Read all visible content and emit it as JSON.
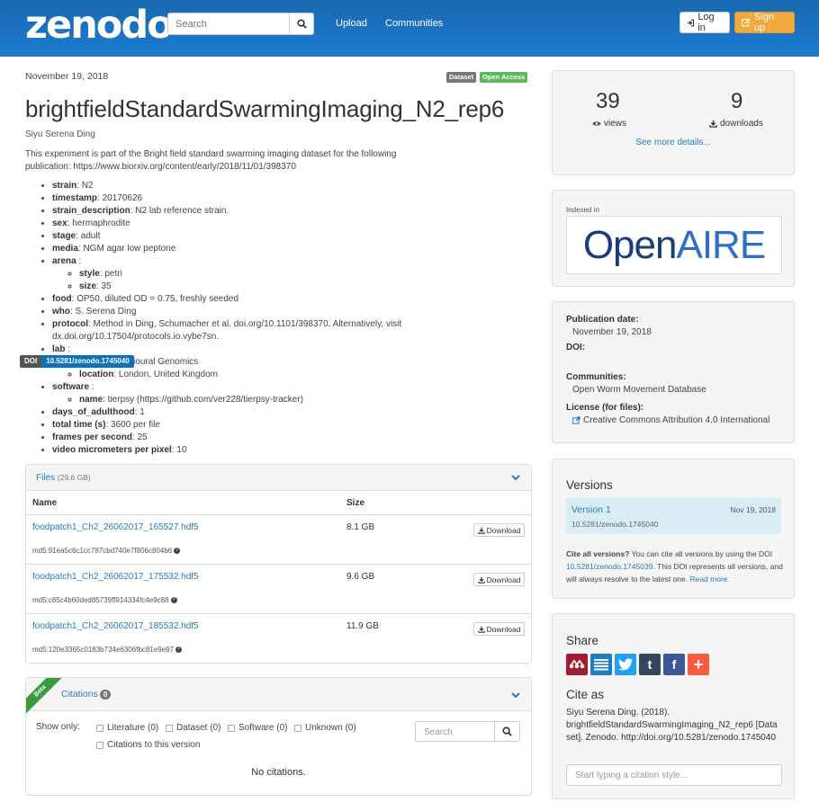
{
  "header": {
    "logo": "zenodo",
    "search_placeholder": "Search",
    "nav": [
      "Upload",
      "Communities"
    ],
    "login_label": "Log in",
    "signup_label": "Sign up"
  },
  "record": {
    "date": "November 19, 2018",
    "badges": [
      "Dataset",
      "Open Access"
    ],
    "title": "brightfieldStandardSwarmingImaging_N2_rep6",
    "author": "Siyu Serena Ding",
    "description": "This experiment is part of the Bright field standard swarming imaging dataset for the following publication: https://www.biorxiv.org/content/early/2018/11/01/398370",
    "metadata": {
      "strain": {
        "k": "strain",
        "v": ": N2"
      },
      "timestamp": {
        "k": "timestamp",
        "v": ": 20170626"
      },
      "strain_description": {
        "k": "strain_description",
        "v": ": N2 lab reference strain."
      },
      "sex": {
        "k": "sex",
        "v": ": hermaphrodite"
      },
      "stage": {
        "k": "stage",
        "v": ": adult"
      },
      "media": {
        "k": "media",
        "v": ": NGM agar low peptone"
      },
      "arena": {
        "k": "arena",
        "v": " :"
      },
      "arena_style": {
        "k": "style",
        "v": ": petri"
      },
      "arena_size": {
        "k": "size",
        "v": ": 35"
      },
      "food": {
        "k": "food",
        "v": ": OP50, diluted OD = 0.75, freshly seeded"
      },
      "who": {
        "k": "who",
        "v": ": S. Serena Ding"
      },
      "protocol": {
        "k": "protocol",
        "v": ": Method in Ding, Schumacher et al. doi.org/10.1101/398370. Alternatively, visit dx.doi.org/10.17504/protocols.io.vybe7sn."
      },
      "lab": {
        "k": "lab",
        "v": " :"
      },
      "lab_name": {
        "k": "name",
        "v": ": Behavioural Genomics"
      },
      "lab_location": {
        "k": "location",
        "v": ": London, United Kingdom"
      },
      "software": {
        "k": "software",
        "v": " :"
      },
      "software_name": {
        "k": "name",
        "v": ": tierpsy (https://github.com/ver228/tierpsy-tracker)"
      },
      "days_of_adulthood": {
        "k": "days_of_adulthood",
        "v": ": 1"
      },
      "total_time": {
        "k": "total time (s)",
        "v": ": 3600 per file"
      },
      "fps": {
        "k": "frames per second",
        "v": ": 25"
      },
      "vmpp": {
        "k": "video micrometers per pixel",
        "v": ": 10"
      }
    }
  },
  "files": {
    "label": "Files",
    "total_size": "(29.6 GB)",
    "col_name": "Name",
    "col_size": "Size",
    "download_label": "Download",
    "rows": [
      {
        "name": "foodpatch1_Ch2_26062017_165527.hdf5",
        "size": "8.1 GB",
        "md5": "md5:91ea5c6c1cc787cbd740e7f806c804b6"
      },
      {
        "name": "foodpatch1_Ch2_26062017_175532.hdf5",
        "size": "9.6 GB",
        "md5": "md5:c85c4b60ded85739ff914334fc4e9c88"
      },
      {
        "name": "foodpatch1_Ch2_26062017_185532.hdf5",
        "size": "11.9 GB",
        "md5": "md5:120e3365c0183b734e6306fbc81e9e97"
      }
    ]
  },
  "citations": {
    "beta": "Beta",
    "label": "Citations",
    "count": "0",
    "show_only": "Show only:",
    "filters": [
      "Literature (0)",
      "Dataset (0)",
      "Software (0)",
      "Unknown (0)"
    ],
    "this_version": "Citations to this version",
    "search_placeholder": "Search",
    "empty": "No citations."
  },
  "stats": {
    "views": "39",
    "views_label": "views",
    "downloads": "9",
    "downloads_label": "downloads",
    "see_more": "See more details..."
  },
  "indexed": {
    "label": "Indexed in",
    "logo_open": "Open",
    "logo_aire": "AIRE"
  },
  "pubinfo": {
    "date_label": "Publication date:",
    "date": "November 19, 2018",
    "doi_label": "DOI:",
    "doi_badge_left": "DOI",
    "doi": "10.5281/zenodo.1745040",
    "communities_label": "Communities:",
    "community": "Open Worm Movement Database",
    "license_label": "License (for files):",
    "license": "Creative Commons Attribution 4.0 International"
  },
  "versions": {
    "title": "Versions",
    "version": "Version 1",
    "version_date": "Nov 19, 2018",
    "version_doi": "10.5281/zenodo.1745040",
    "cite_all_bold": "Cite all versions?",
    "cite_all_text": " You can cite all versions by using the DOI ",
    "cite_all_doi": "10.5281/zenodo.1745039",
    "cite_all_text2": ". This DOI represents all versions, and will always resolve to the latest one. ",
    "read_more": "Read more."
  },
  "share": {
    "title": "Share",
    "icons": [
      "mendeley-icon",
      "citeulike-icon",
      "twitter-icon",
      "tumblr-icon",
      "facebook-icon",
      "addthis-icon"
    ],
    "colors": [
      "#a6192e",
      "#1f7ec2",
      "#1da1f2",
      "#35465c",
      "#3b5998",
      "#f95c3f"
    ],
    "cite_as": "Cite as",
    "citation": "Siyu Serena Ding. (2018). brightfieldStandardSwarmingImaging_N2_rep6 [Data set]. Zenodo. http://doi.org/10.5281/zenodo.1745040",
    "style_placeholder": "Start typing a citation style..."
  }
}
